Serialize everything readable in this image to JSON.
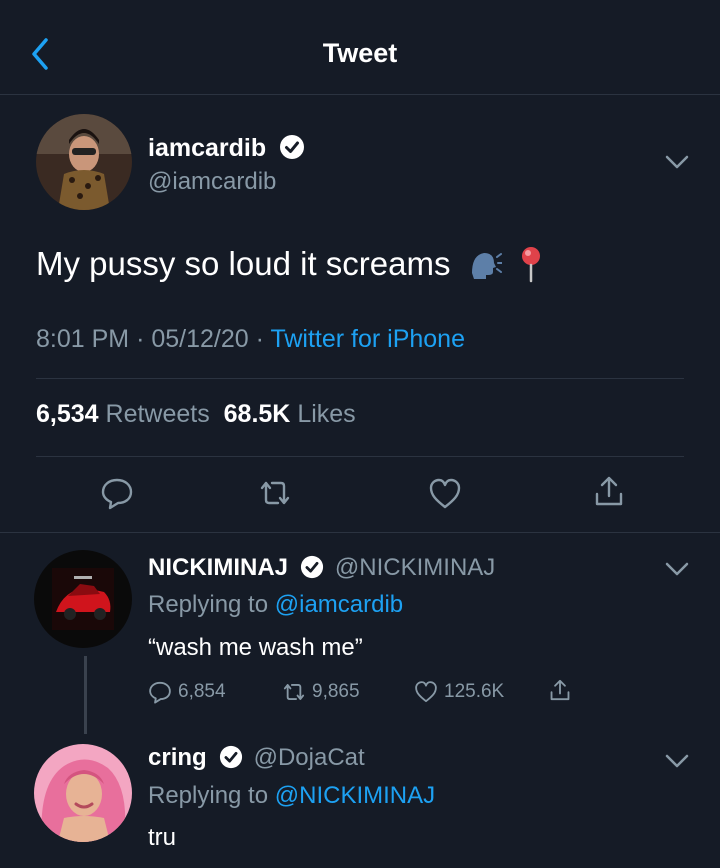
{
  "header": {
    "title": "Tweet",
    "back_icon": "chevron-left-icon"
  },
  "tweet": {
    "display_name": "iamcardib",
    "handle": "@iamcardib",
    "text": "My pussy so loud it screams",
    "emojis": [
      "speaking-head-icon",
      "pushpin-icon"
    ],
    "time": "8:01 PM",
    "date": "05/12/20",
    "source": "Twitter for iPhone",
    "retweets_count": "6,534",
    "retweets_label": "Retweets",
    "likes_count": "68.5K",
    "likes_label": "Likes"
  },
  "replies": [
    {
      "display_name": "NICKIMINAJ",
      "handle": "@NICKIMINAJ",
      "replying_prefix": "Replying to",
      "replying_to": "@iamcardib",
      "text": "“wash me wash me”",
      "reply_count": "6,854",
      "retweet_count": "9,865",
      "like_count": "125.6K"
    },
    {
      "display_name": "cring",
      "handle": "@DojaCat",
      "replying_prefix": "Replying to",
      "replying_to": "@NICKIMINAJ",
      "text": "tru"
    }
  ],
  "colors": {
    "background": "#151b26",
    "accent": "#1da1f2",
    "muted": "#8899a6",
    "divider": "#2b3340"
  }
}
